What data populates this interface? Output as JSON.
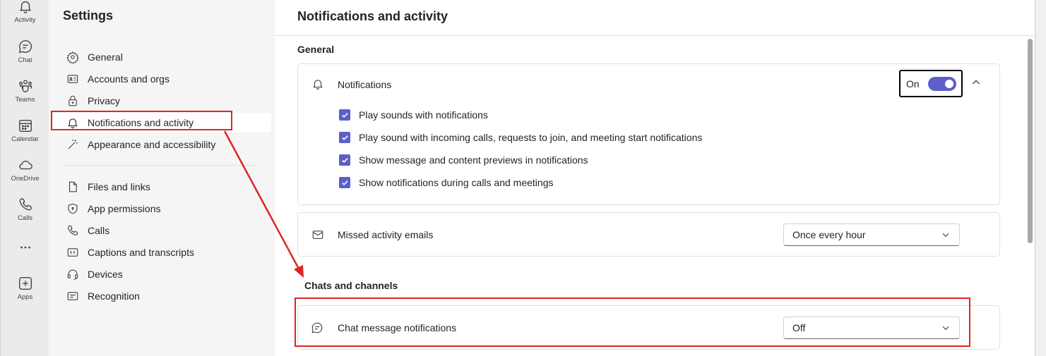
{
  "rail": {
    "items": [
      {
        "label": "Activity",
        "icon": "bell-icon"
      },
      {
        "label": "Chat",
        "icon": "chat-icon"
      },
      {
        "label": "Teams",
        "icon": "teams-icon"
      },
      {
        "label": "Calendar",
        "icon": "calendar-icon"
      },
      {
        "label": "OneDrive",
        "icon": "cloud-icon"
      },
      {
        "label": "Calls",
        "icon": "phone-icon"
      },
      {
        "label": "...",
        "icon": "more-icon"
      },
      {
        "label": "Apps",
        "icon": "add-icon"
      }
    ]
  },
  "settings": {
    "title": "Settings",
    "items": [
      {
        "label": "General",
        "icon": "gear-icon"
      },
      {
        "label": "Accounts and orgs",
        "icon": "id-card-icon"
      },
      {
        "label": "Privacy",
        "icon": "lock-icon"
      },
      {
        "label": "Notifications and activity",
        "icon": "bell-icon",
        "active": true
      },
      {
        "label": "Appearance and accessibility",
        "icon": "wand-icon"
      },
      {
        "label": "Files and links",
        "icon": "file-icon"
      },
      {
        "label": "App permissions",
        "icon": "shield-icon"
      },
      {
        "label": "Calls",
        "icon": "phone-icon"
      },
      {
        "label": "Captions and transcripts",
        "icon": "captions-icon"
      },
      {
        "label": "Devices",
        "icon": "headset-icon"
      },
      {
        "label": "Recognition",
        "icon": "recognition-icon"
      }
    ]
  },
  "main": {
    "title": "Notifications and activity",
    "general": {
      "heading": "General",
      "notifications": {
        "label": "Notifications",
        "toggle_label": "On",
        "toggle_on": true,
        "checks": [
          {
            "label": "Play sounds with notifications",
            "checked": true
          },
          {
            "label": "Play sound with incoming calls, requests to join, and meeting start notifications",
            "checked": true
          },
          {
            "label": "Show message and content previews in notifications",
            "checked": true
          },
          {
            "label": "Show notifications during calls and meetings",
            "checked": true
          }
        ]
      },
      "missed": {
        "label": "Missed activity emails",
        "value": "Once every hour"
      }
    },
    "chats": {
      "heading": "Chats and channels",
      "chat_msg": {
        "label": "Chat message notifications",
        "value": "Off"
      }
    }
  },
  "colors": {
    "accent": "#5b5fc7",
    "annotation": "#e02424"
  }
}
